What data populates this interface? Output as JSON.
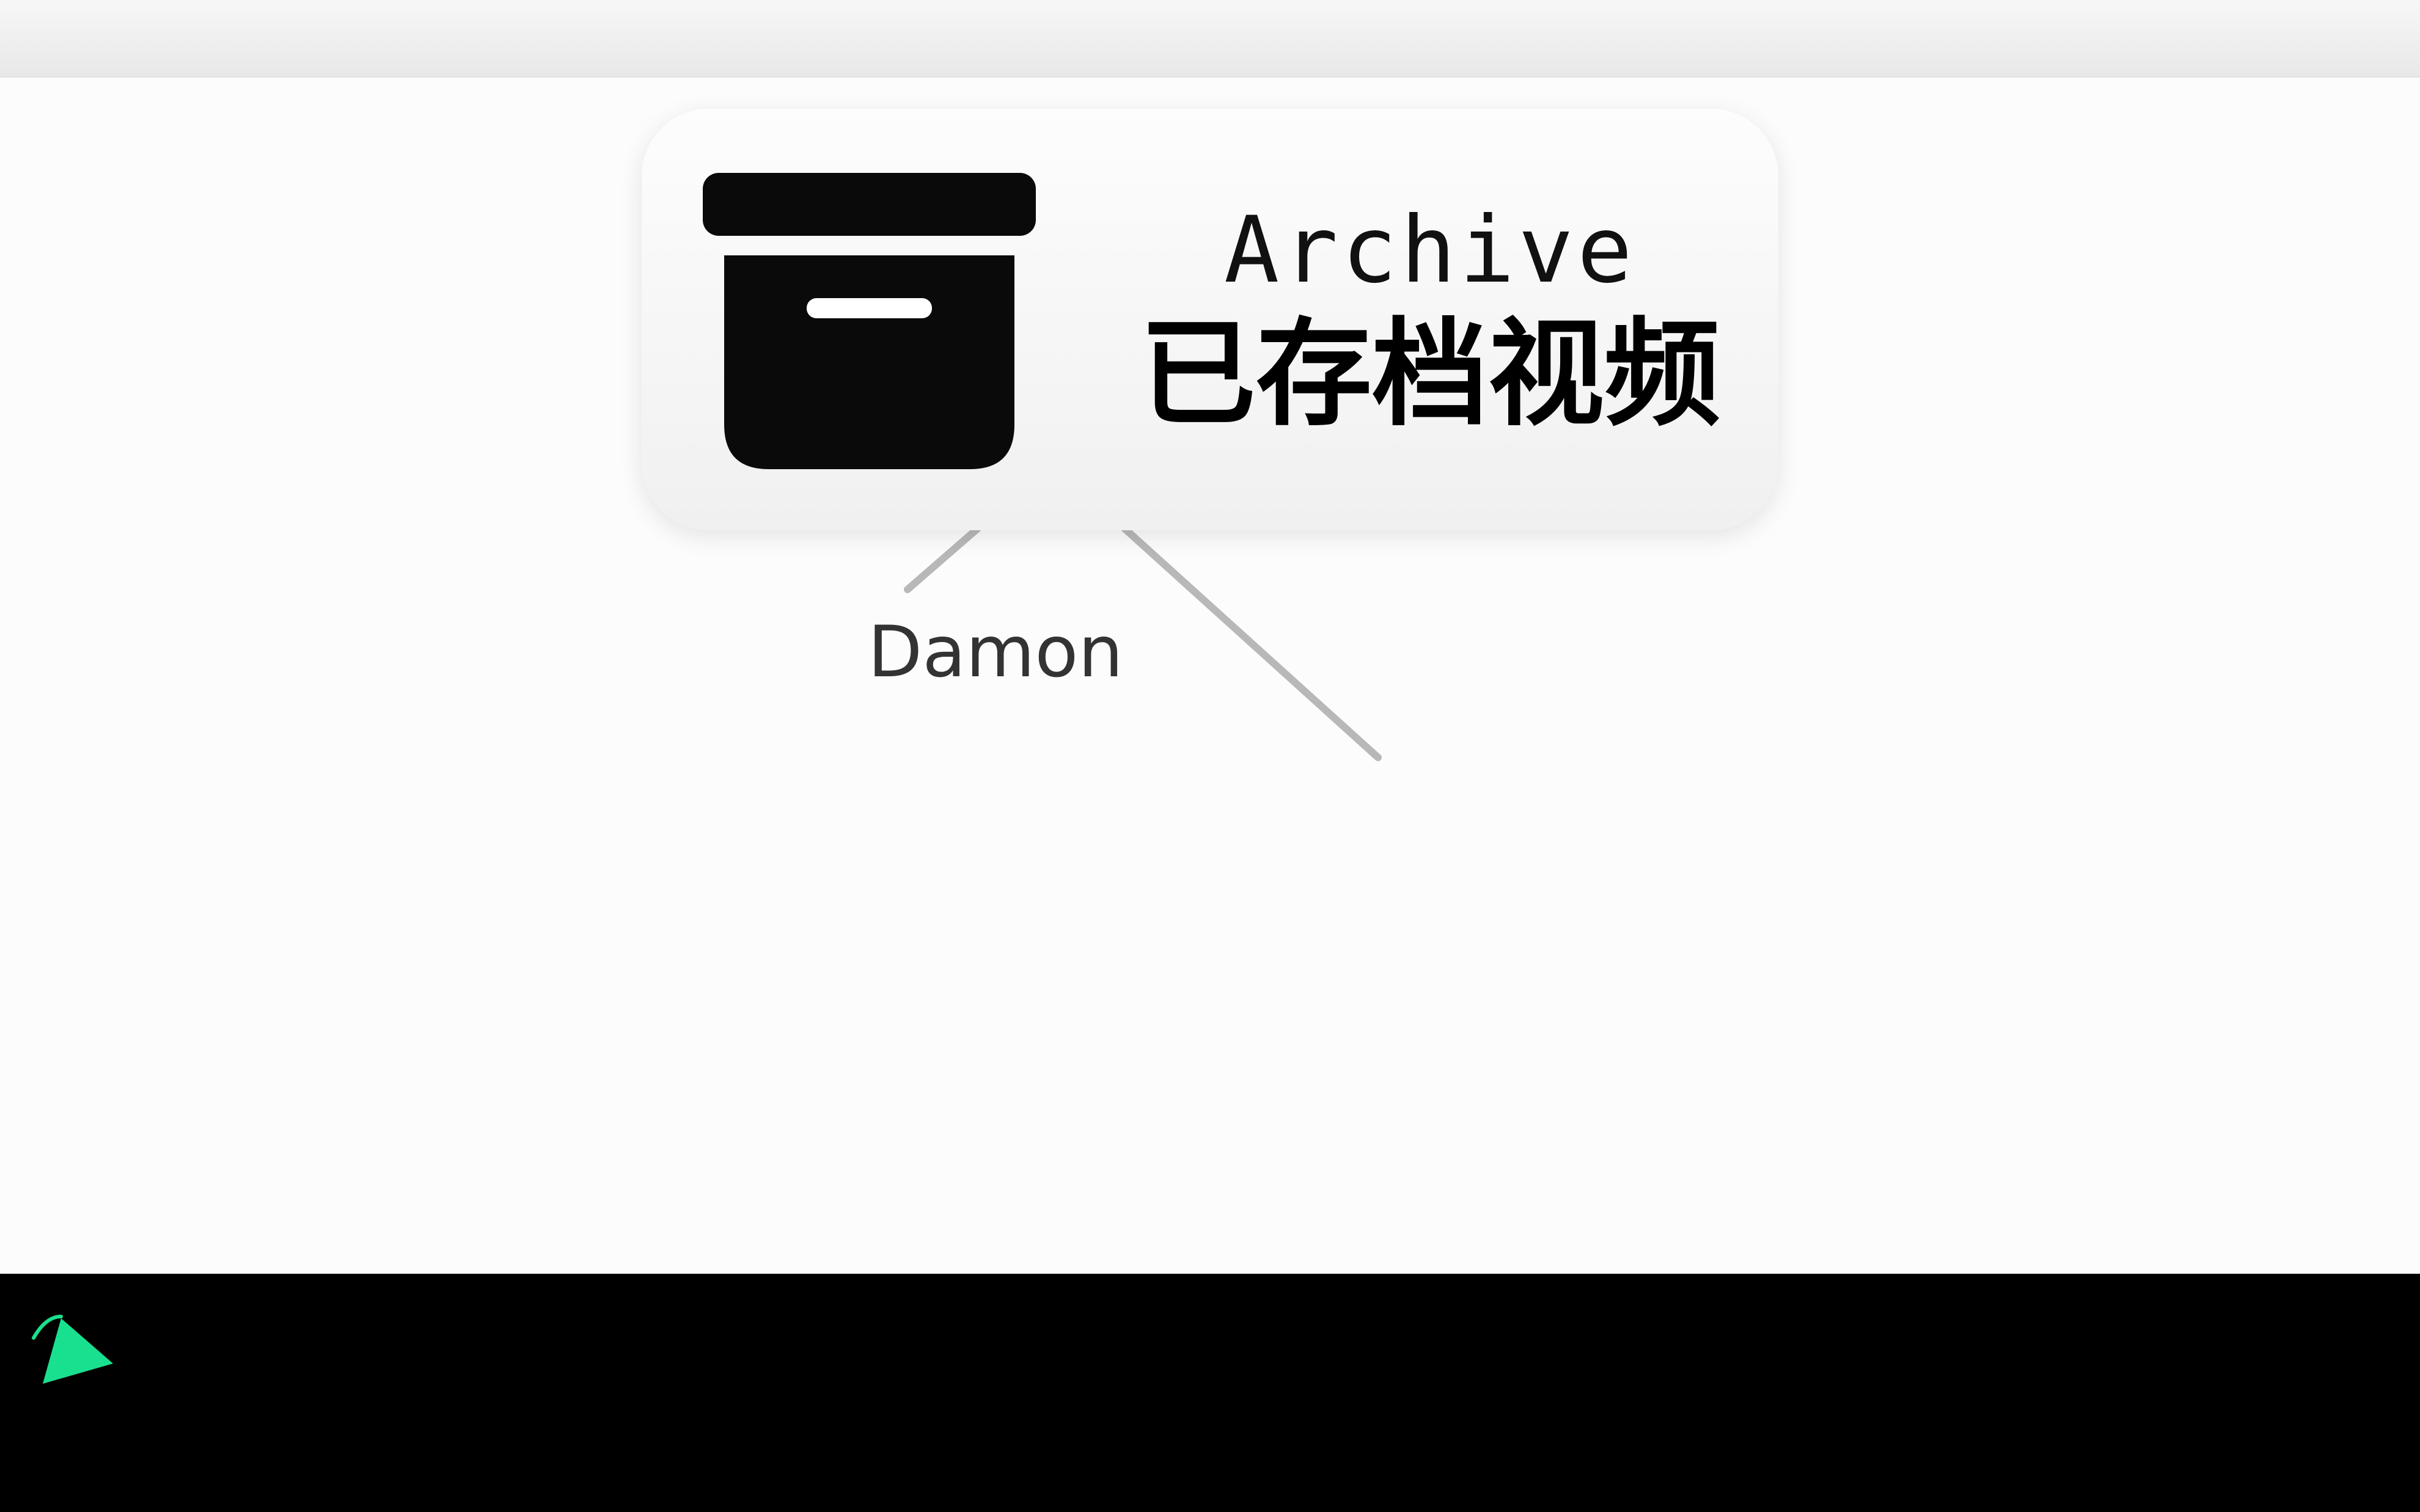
{
  "card": {
    "title_en": "Archive",
    "title_zh": "已存档视频",
    "icon": "archive-box-icon"
  },
  "node": {
    "label": "Damon"
  },
  "colors": {
    "accent": "#19e08f",
    "card_text": "#000000",
    "connector": "#b8b8b8",
    "bottom_bar": "#000000"
  },
  "bottom_bar": {
    "icon": "pointer-icon"
  }
}
